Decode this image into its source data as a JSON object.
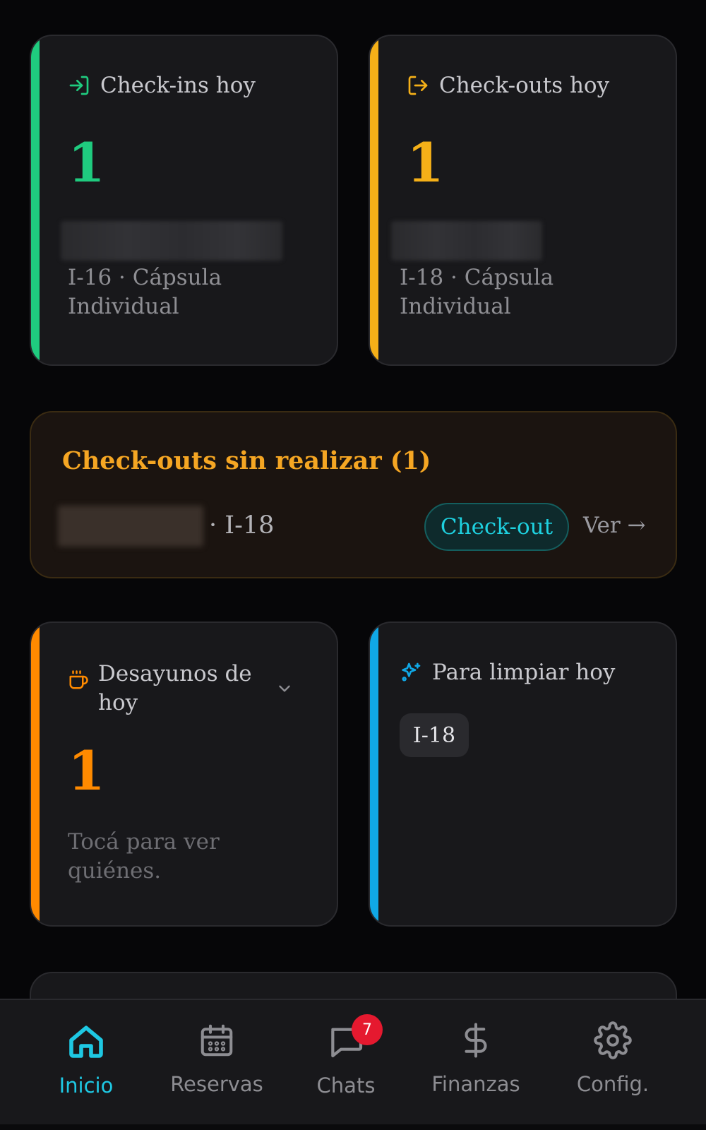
{
  "colors": {
    "checkin_accent": "#1fcb7f",
    "checkout_accent": "#f5b018",
    "breakfast_accent": "#ff8a00",
    "clean_accent": "#10a8e6",
    "active_nav": "#1ec8e3",
    "badge": "#e5192f"
  },
  "checkins": {
    "icon": "login-arrow-icon",
    "title": "Check-ins hoy",
    "count": "1",
    "detail": "I-16 · Cápsula Individual"
  },
  "checkouts": {
    "icon": "logout-arrow-icon",
    "title": "Check-outs hoy",
    "count": "1",
    "detail": "I-18 · Cápsula Individual"
  },
  "pending_checkouts": {
    "title": "Check-outs sin realizar (1)",
    "room": "· I-18",
    "action_label": "Check-out",
    "view_label": "Ver →"
  },
  "breakfast": {
    "icon": "coffee-cup-icon",
    "title": "Desayunos de hoy",
    "count": "1",
    "hint": "Tocá para ver quiénes."
  },
  "cleaning": {
    "icon": "sparkles-icon",
    "title": "Para limpiar hoy",
    "rooms": [
      "I-18"
    ]
  },
  "nav": {
    "items": [
      {
        "label": "Inicio",
        "icon": "home-icon",
        "active": true
      },
      {
        "label": "Reservas",
        "icon": "calendar-icon",
        "active": false
      },
      {
        "label": "Chats",
        "icon": "chat-bubble-icon",
        "active": false,
        "badge": "7"
      },
      {
        "label": "Finanzas",
        "icon": "dollar-icon",
        "active": false
      },
      {
        "label": "Config.",
        "icon": "gear-icon",
        "active": false
      }
    ]
  }
}
